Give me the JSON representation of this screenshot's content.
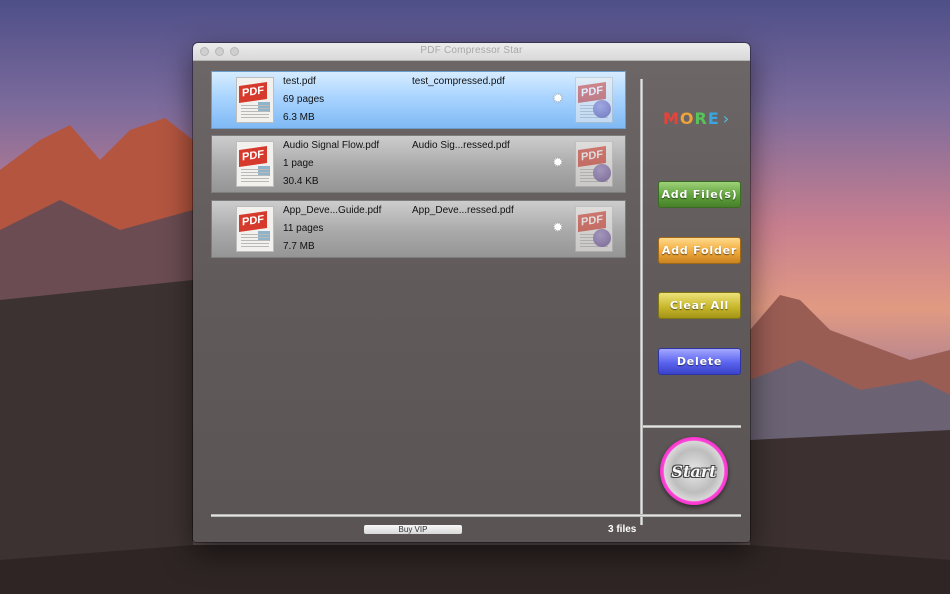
{
  "window": {
    "title": "PDF Compressor Star"
  },
  "files": [
    {
      "input_name": "test.pdf",
      "output_name": "test_compressed.pdf",
      "pages": "69 pages",
      "size": "6.3 MB",
      "selected": true
    },
    {
      "input_name": "Audio Signal Flow.pdf",
      "output_name": "Audio Sig...ressed.pdf",
      "pages": "1 page",
      "size": "30.4 KB",
      "selected": false
    },
    {
      "input_name": "App_Deve...Guide.pdf",
      "output_name": "App_Deve...ressed.pdf",
      "pages": "11 pages",
      "size": "7.7 MB",
      "selected": false
    }
  ],
  "thumbnail_label": "PDF",
  "more": {
    "letters": [
      "M",
      "O",
      "R",
      "E"
    ],
    "arrow": "›"
  },
  "buttons": {
    "add_files": "Add File(s)",
    "add_folder": "Add Folder",
    "clear_all": "Clear All",
    "delete": "Delete",
    "start": "Start"
  },
  "footer": {
    "buy_vip": "Buy VIP",
    "file_count": "3 files"
  },
  "colors": {
    "add_files": "#5fa23c",
    "add_folder": "#f0a93a",
    "clear_all": "#c9b82c",
    "delete": "#5a63ef",
    "start_ring": "#e21bb7",
    "selected_row": "#a9d4ff"
  }
}
